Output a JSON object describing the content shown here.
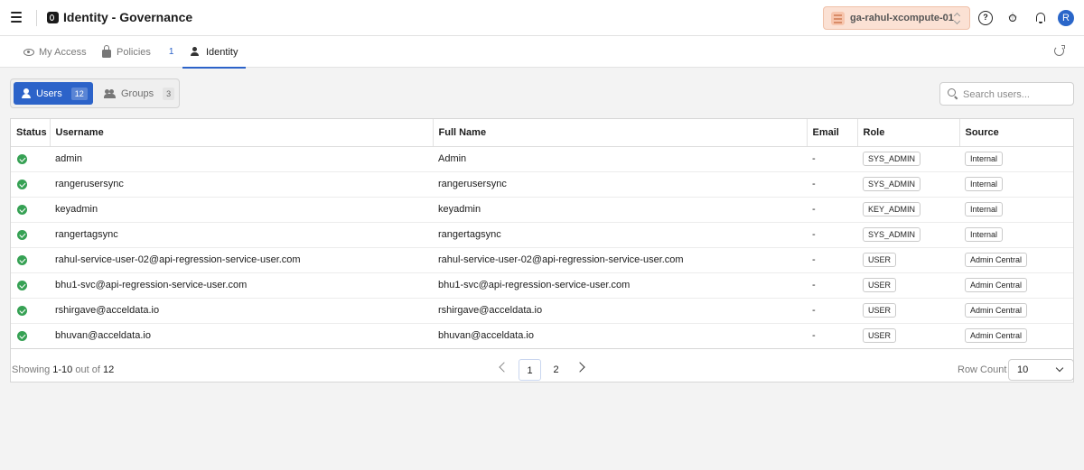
{
  "header": {
    "title": "Identity - Governance",
    "environment": "ga-rahul-xcompute-01",
    "avatar_initial": "R"
  },
  "tabs": [
    {
      "label": "My Access"
    },
    {
      "label": "Policies",
      "count": "1"
    },
    {
      "label": "Identity"
    }
  ],
  "segments": {
    "users": {
      "label": "Users",
      "count": "12"
    },
    "groups": {
      "label": "Groups",
      "count": "3"
    }
  },
  "search": {
    "placeholder": "Search users..."
  },
  "table": {
    "columns": [
      "Status",
      "Username",
      "Full Name",
      "Email",
      "Role",
      "Source"
    ],
    "rows": [
      {
        "username": "admin",
        "full_name": "Admin",
        "email": "-",
        "role": "SYS_ADMIN",
        "source": "Internal"
      },
      {
        "username": "rangerusersync",
        "full_name": "rangerusersync",
        "email": "-",
        "role": "SYS_ADMIN",
        "source": "Internal"
      },
      {
        "username": "keyadmin",
        "full_name": "keyadmin",
        "email": "-",
        "role": "KEY_ADMIN",
        "source": "Internal"
      },
      {
        "username": "rangertagsync",
        "full_name": "rangertagsync",
        "email": "-",
        "role": "SYS_ADMIN",
        "source": "Internal"
      },
      {
        "username": "rahul-service-user-02@api-regression-service-user.com",
        "full_name": "rahul-service-user-02@api-regression-service-user.com",
        "email": "-",
        "role": "USER",
        "source": "Admin Central"
      },
      {
        "username": "bhu1-svc@api-regression-service-user.com",
        "full_name": "bhu1-svc@api-regression-service-user.com",
        "email": "-",
        "role": "USER",
        "source": "Admin Central"
      },
      {
        "username": "rshirgave@acceldata.io",
        "full_name": "rshirgave@acceldata.io",
        "email": "-",
        "role": "USER",
        "source": "Admin Central"
      },
      {
        "username": "bhuvan@acceldata.io",
        "full_name": "bhuvan@acceldata.io",
        "email": "-",
        "role": "USER",
        "source": "Admin Central"
      }
    ]
  },
  "pagination": {
    "showing_prefix": "Showing",
    "range": "1-10",
    "out_of": "out of",
    "total": "12",
    "pages": [
      "1",
      "2"
    ],
    "row_count_label": "Row Count",
    "row_count_value": "10"
  },
  "colors": {
    "accent": "#2c63c9",
    "status_ok": "#36a154",
    "env_chip_bg": "#fbe1d4"
  }
}
